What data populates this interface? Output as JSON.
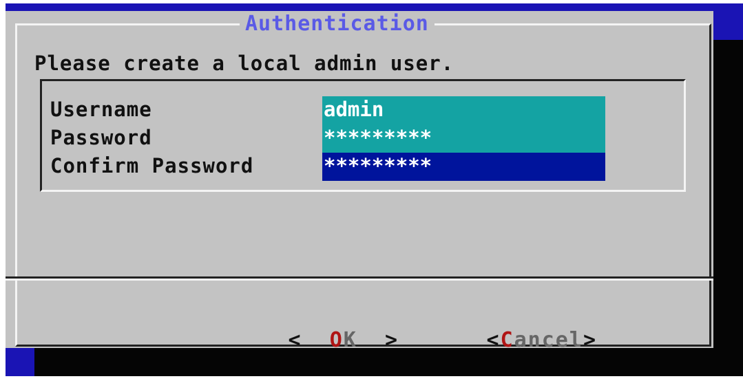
{
  "dialog": {
    "title": "Authentication",
    "prompt": "Please create a local admin user."
  },
  "form": {
    "fields": [
      {
        "label": "Username",
        "value": "admin"
      },
      {
        "label": "Password",
        "value": "*********"
      },
      {
        "label": "Confirm Password",
        "value": "*********"
      }
    ]
  },
  "buttons": {
    "ok": {
      "open": "<",
      "hotkey": "O",
      "rest": "K",
      "close": ">"
    },
    "cancel": {
      "open": "<",
      "hotkey": "C",
      "rest": "ancel",
      "close": ">"
    }
  },
  "colors": {
    "background": "#1a14b4",
    "dialog": "#c3c3c3",
    "title": "#5a5ae6",
    "field": "#14a3a3",
    "field_focused": "#00149c",
    "hotkey": "#b01515"
  }
}
